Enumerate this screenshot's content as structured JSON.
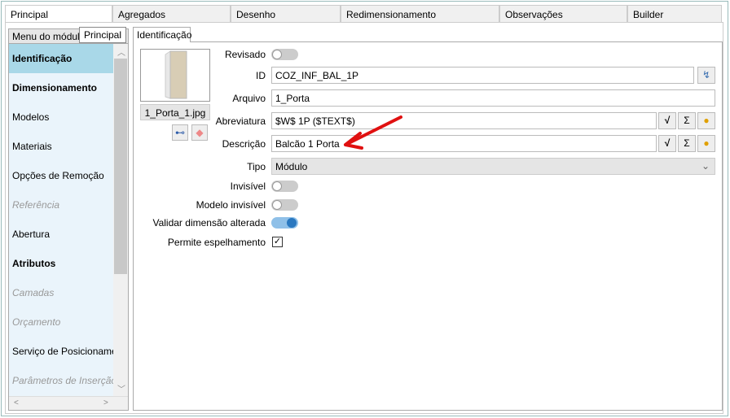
{
  "tabs": [
    "Principal",
    "Agregados",
    "Desenho",
    "Redimensionamento",
    "Observações",
    "Builder"
  ],
  "left_panel": {
    "header": "Menu do módulo",
    "tooltip": "Principal",
    "items": [
      "Identificação",
      "Dimensionamento",
      "Modelos",
      "Materiais",
      "Opções de Remoção",
      "Referência",
      "Abertura",
      "Atributos",
      "Camadas",
      "Orçamento",
      "Serviço de Posicionamento",
      "Parâmetros de Inserção"
    ]
  },
  "right_tab": "Identificação",
  "image": {
    "filename": "1_Porta_1.jpg"
  },
  "form": {
    "revisado": {
      "label": "Revisado",
      "on": false
    },
    "id": {
      "label": "ID",
      "value": "COZ_INF_BAL_1P"
    },
    "arquivo": {
      "label": "Arquivo",
      "value": "1_Porta"
    },
    "abreviatura": {
      "label": "Abreviatura",
      "value": "$W$ 1P ($TEXT$)"
    },
    "descricao": {
      "label": "Descrição",
      "value": "Balcão 1 Porta"
    },
    "tipo": {
      "label": "Tipo",
      "value": "Módulo"
    },
    "invisivel": {
      "label": "Invisível",
      "on": false
    },
    "modelo_invisivel": {
      "label": "Modelo invisível",
      "on": false
    },
    "validar": {
      "label": "Validar dimensão alterada",
      "on": true
    },
    "espelhamento": {
      "label": "Permite espelhamento",
      "checked": true
    }
  },
  "icons": {
    "sigma": "Σ",
    "check": "✓"
  }
}
